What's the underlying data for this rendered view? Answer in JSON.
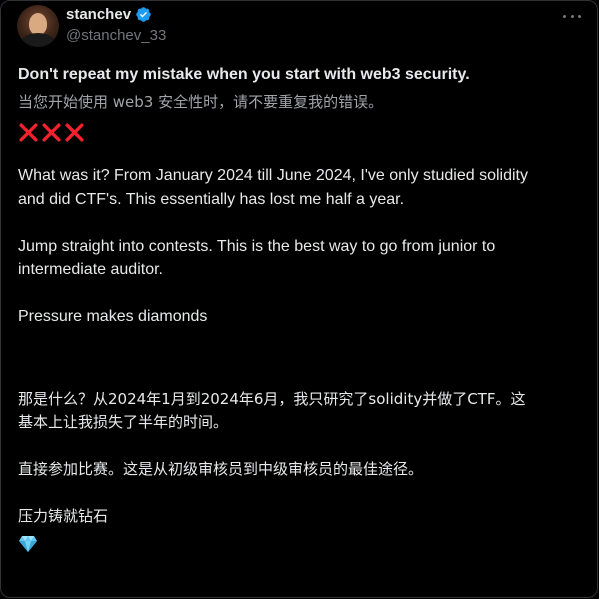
{
  "author": {
    "display_name": "stanchev",
    "handle": "@stanchev_33"
  },
  "post": {
    "title_en": "Don't repeat my mistake when you start with web3 security.",
    "title_zh": "当您开始使用 web3 安全性时，请不要重复我的错误。",
    "marks_icon": "cross-mark-icon",
    "para1_line1": "What was it? From January 2024 till June 2024, I've only studied solidity",
    "para1_line2": "and did CTF's. This essentially has lost me half a year.",
    "para2_line1": "Jump straight into contests. This is the best way to go from junior to",
    "para2_line2": "intermediate auditor.",
    "para3": "Pressure makes diamonds",
    "zh_para1_line1": "那是什么？从2024年1月到2024年6月，我只研究了solidity并做了CTF。这",
    "zh_para1_line2": "基本上让我损失了半年的时间。",
    "zh_para2": "直接参加比赛。这是从初级审核员到中级审核员的最佳途径。",
    "zh_para3": "压力铸就钻石",
    "gem_icon": "gem-stone-icon"
  },
  "colors": {
    "background": "#000000",
    "text": "#e7e9ea",
    "muted": "#71767b",
    "verified": "#1d9bf0",
    "cross": "#f4212e",
    "gem": "#5ec8f2"
  }
}
